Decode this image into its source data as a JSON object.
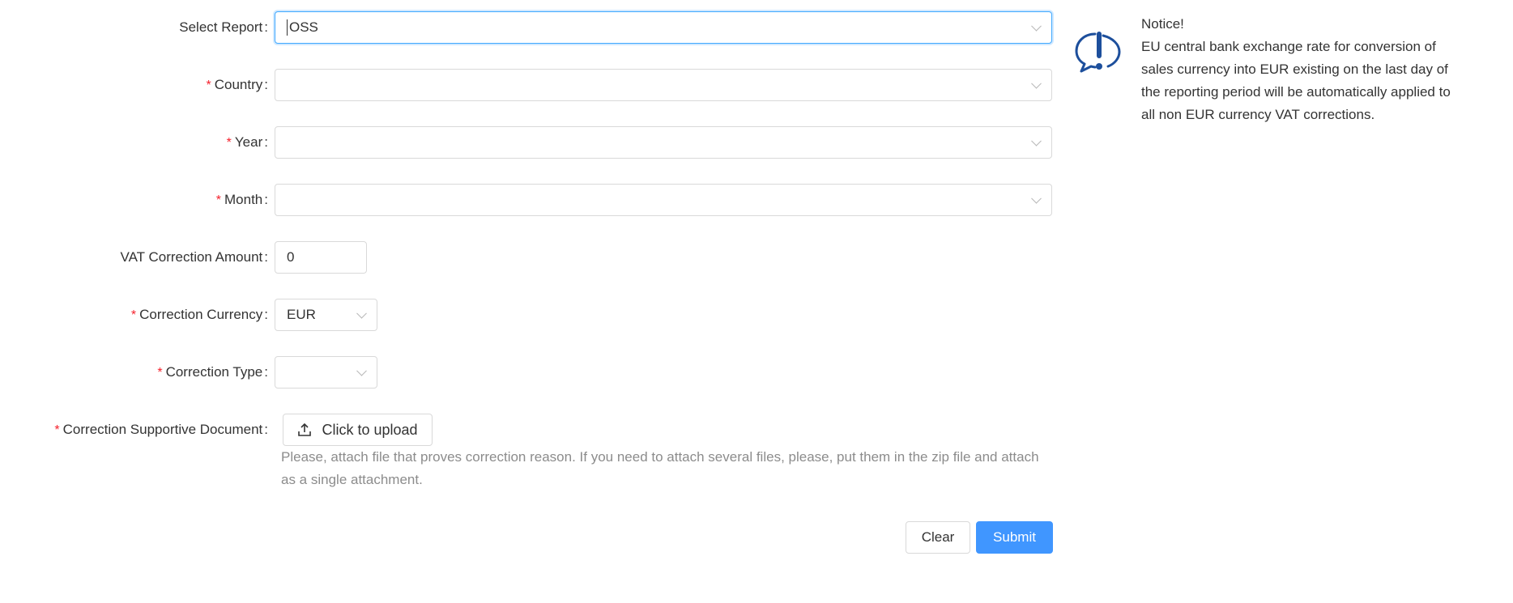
{
  "form": {
    "select_report": {
      "label": "Select Report",
      "value": "OSS"
    },
    "country": {
      "label": "Country",
      "value": ""
    },
    "year": {
      "label": "Year",
      "value": ""
    },
    "month": {
      "label": "Month",
      "value": ""
    },
    "vat_amount": {
      "label": "VAT Correction Amount",
      "value": "0"
    },
    "currency": {
      "label": "Correction Currency",
      "value": "EUR"
    },
    "type": {
      "label": "Correction Type",
      "value": ""
    },
    "document": {
      "label": "Correction Supportive Document",
      "upload_label": "Click to upload",
      "hint": "Please, attach file that proves correction reason. If you need to attach several files, please, put them in the zip file and attach as a single attachment."
    },
    "required_mark": "*",
    "colon": ":"
  },
  "actions": {
    "clear": "Clear",
    "submit": "Submit"
  },
  "notice": {
    "title": "Notice!",
    "body": "EU central bank exchange rate for conversion of sales currency into EUR existing on the last day of the reporting period will be automatically applied to all non EUR currency VAT corrections.",
    "icon": "speech-exclamation-icon"
  },
  "colors": {
    "accent": "#4096ff",
    "required": "#f5222d",
    "icon": "#1d4f9c"
  }
}
